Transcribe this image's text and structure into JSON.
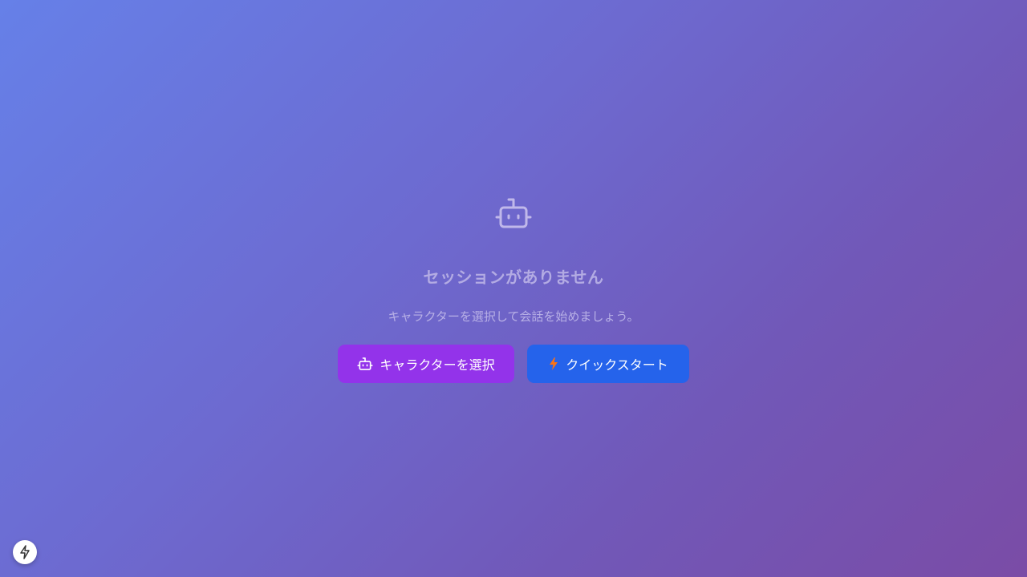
{
  "empty_state": {
    "icon": "robot-icon",
    "title": "セッションがありません",
    "subtitle": "キャラクターを選択して会話を始めましょう。"
  },
  "actions": {
    "select_character": {
      "label": "キャラクターを選択",
      "icon": "robot-icon",
      "color": "#9333ea"
    },
    "quick_start": {
      "label": "クイックスタート",
      "icon": "lightning-icon",
      "color": "#2563eb"
    }
  },
  "dev_indicator": {
    "icon": "lightning-bolt-icon"
  }
}
